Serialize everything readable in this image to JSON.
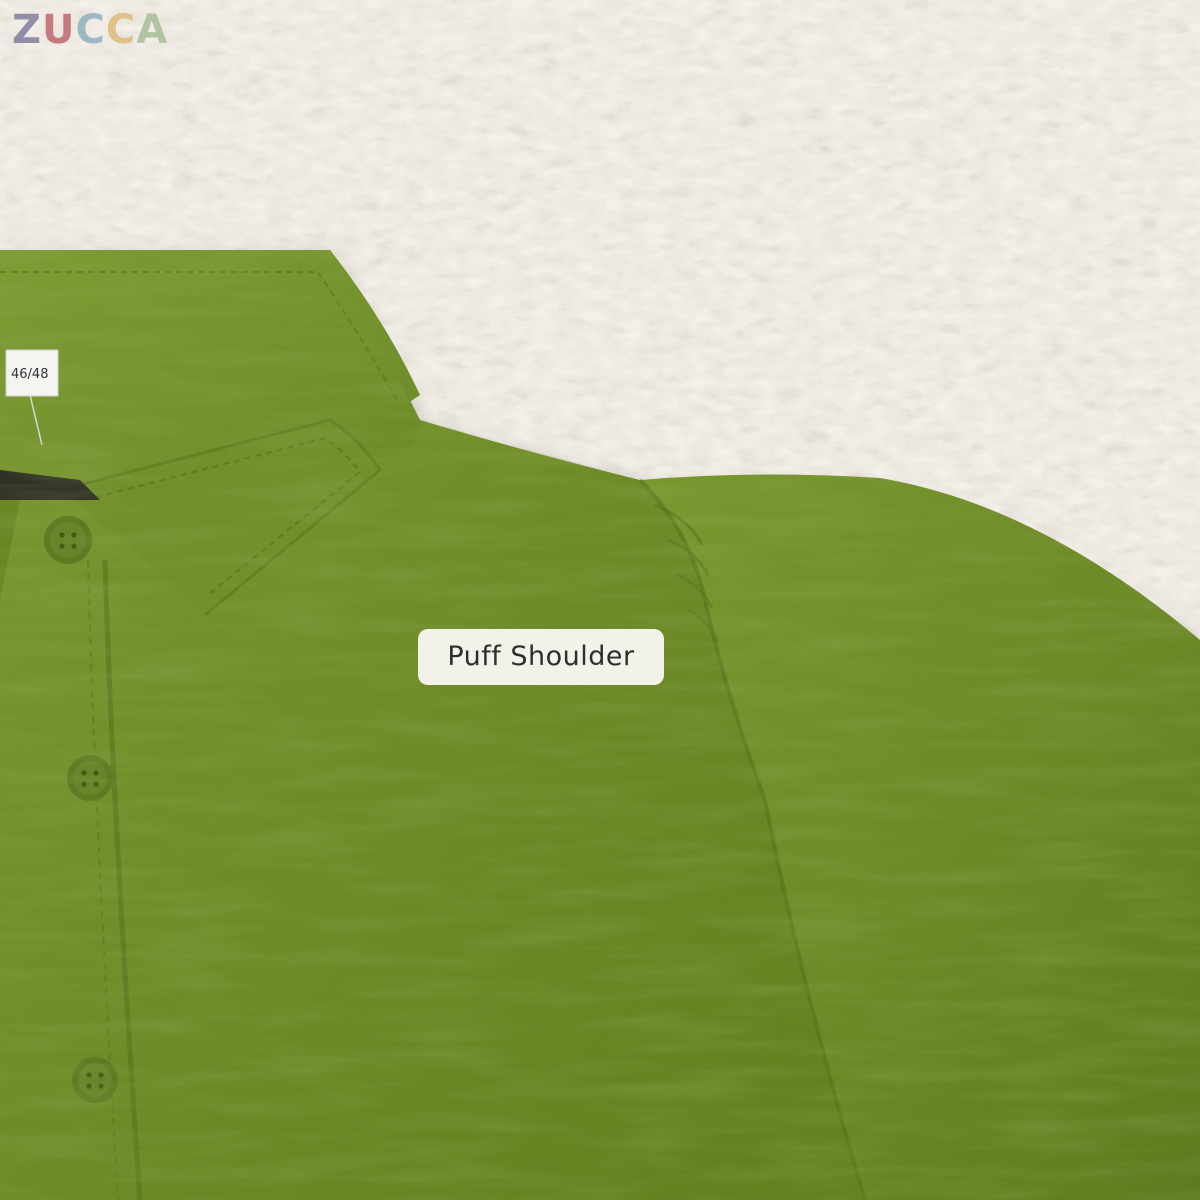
{
  "brand": {
    "logo_letters": [
      {
        "char": "Z",
        "color": "#6f6a8f"
      },
      {
        "char": "U",
        "color": "#b7505a"
      },
      {
        "char": "C",
        "color": "#7fa6b5"
      },
      {
        "char": "C",
        "color": "#d9b36a"
      },
      {
        "char": "A",
        "color": "#9bb58a"
      }
    ]
  },
  "callout": {
    "label": "Puff Shoulder"
  },
  "size_tag": {
    "text": "46/48"
  },
  "colors": {
    "shirt_base": "#6f8c2a",
    "shirt_light": "#7d9a33",
    "shirt_shadow": "#5b7620",
    "rug": "#ece7df",
    "rug_shadow": "#cfc7ba",
    "label_bg": "#f3f2ea"
  }
}
